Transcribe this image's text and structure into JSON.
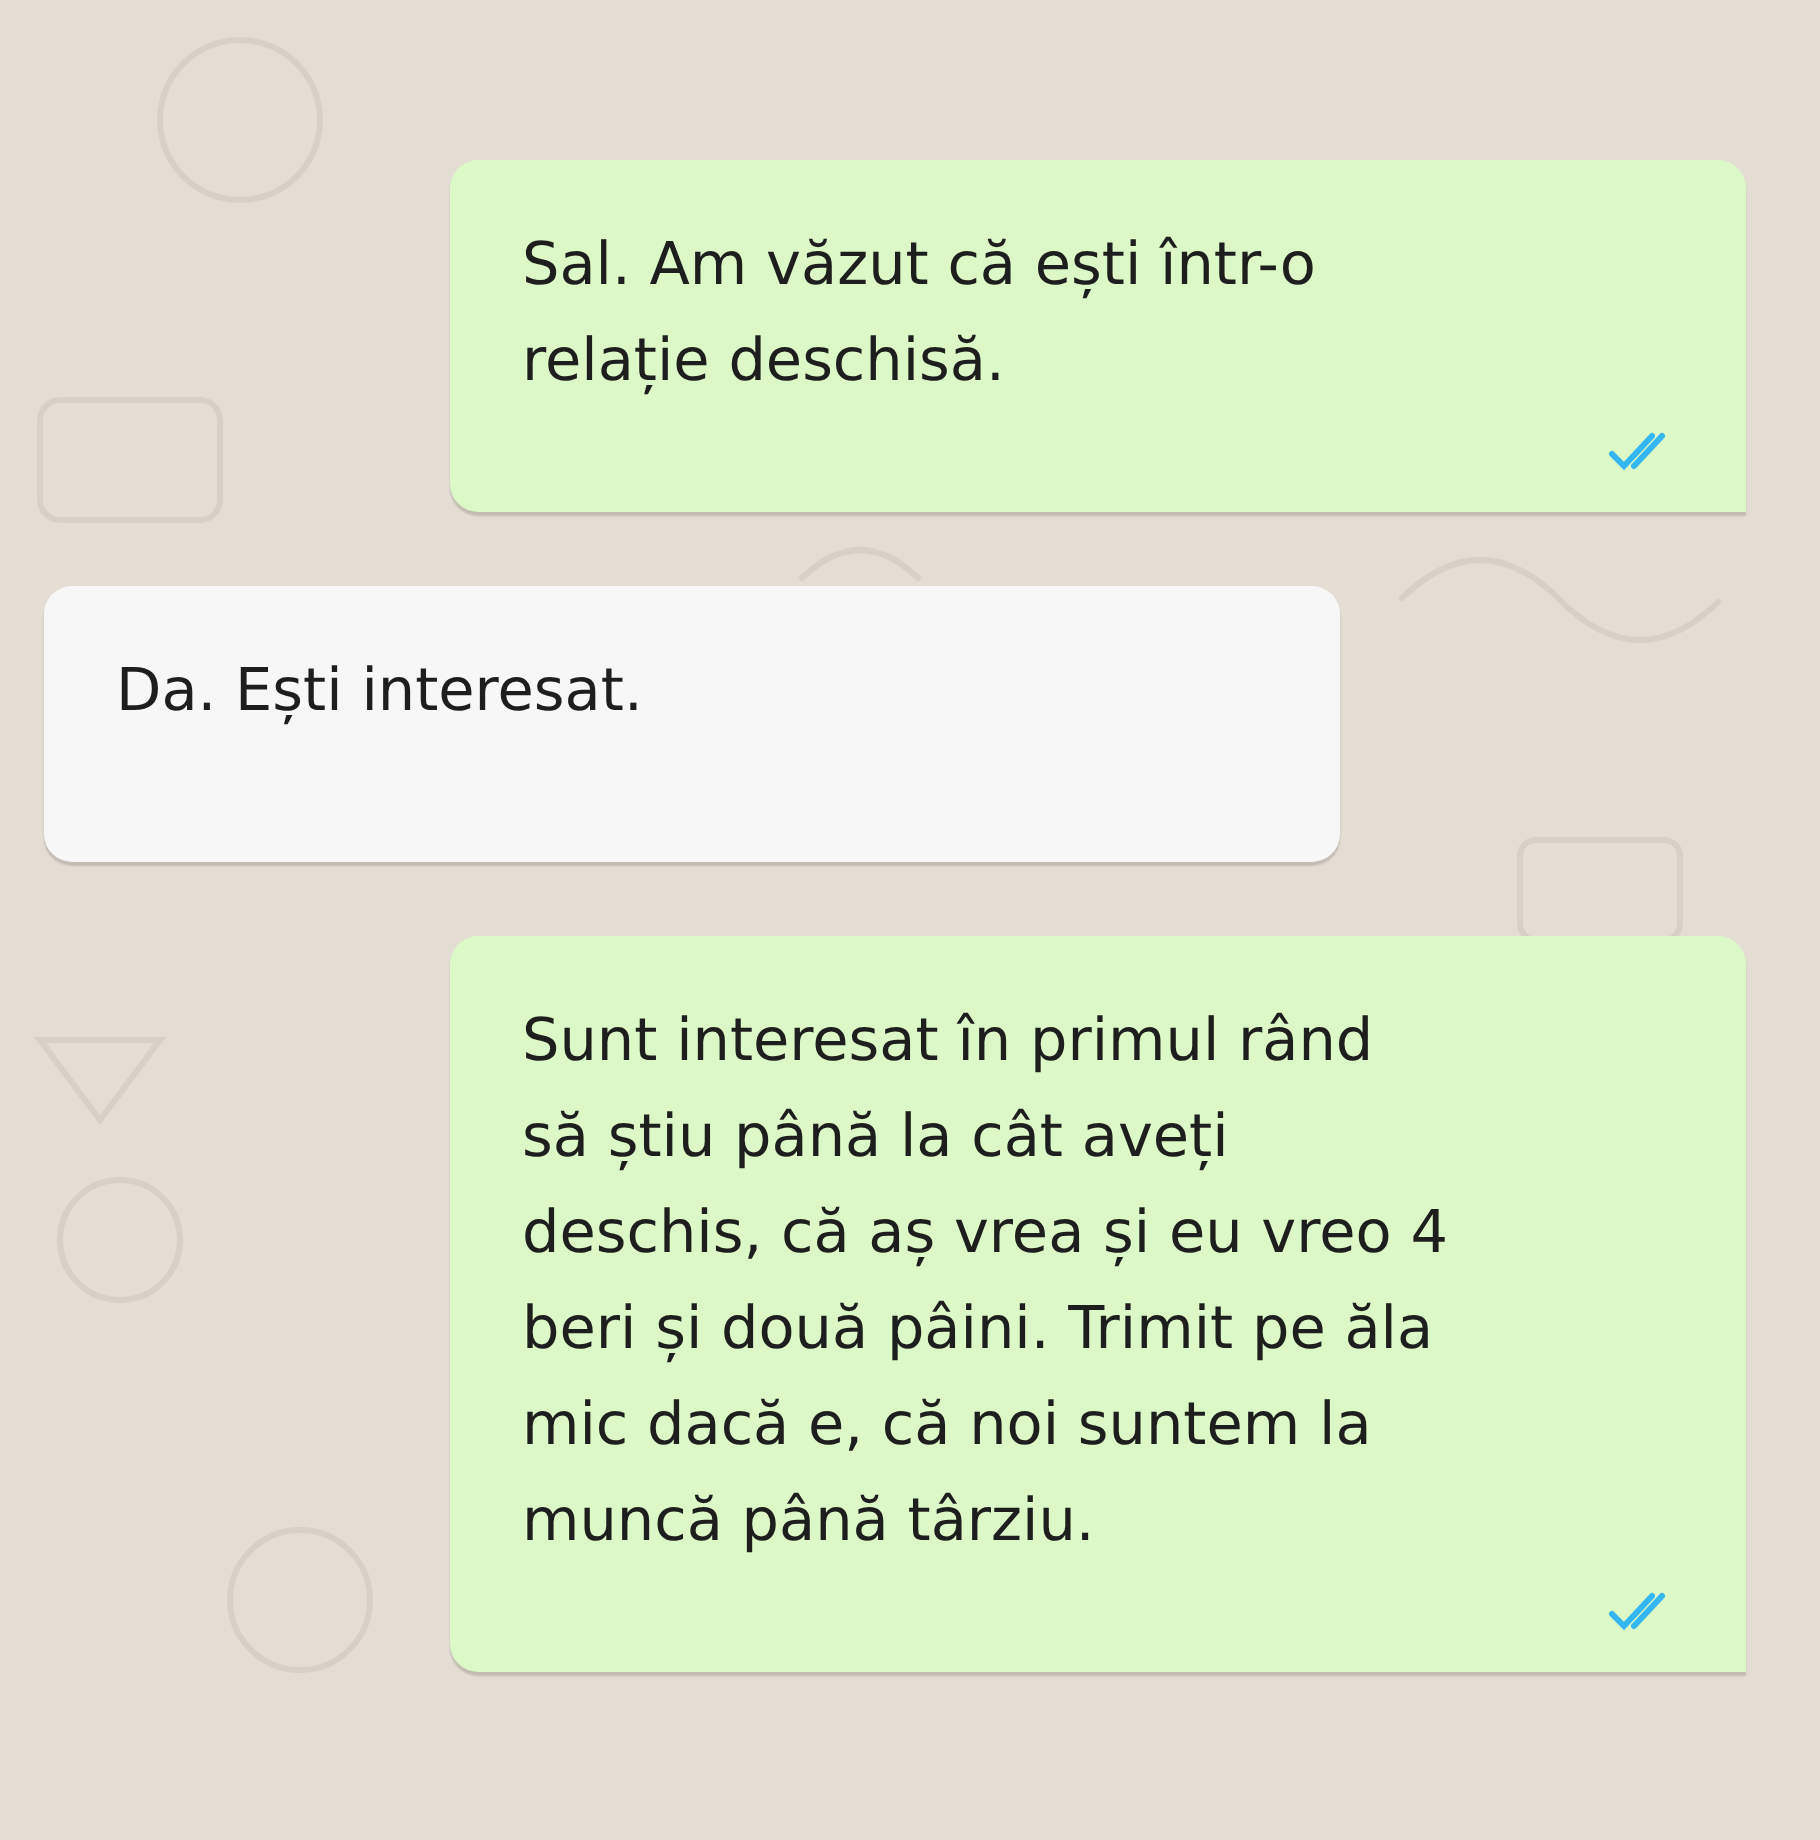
{
  "messages": [
    {
      "kind": "outgoing",
      "lines": [
        "Sal. Am văzut că ești într-o",
        "relație deschisă."
      ],
      "read": true
    },
    {
      "kind": "incoming",
      "lines": [
        "Da. Ești interesat."
      ]
    },
    {
      "kind": "outgoing",
      "lines": [
        "Sunt interesat în primul rând",
        "să știu până la cât aveți",
        "deschis, că aș vrea și eu vreo 4",
        "beri și două pâini. Trimit pe ăla",
        "mic dacă e, că noi suntem la",
        "muncă până târziu."
      ],
      "read": true
    }
  ]
}
